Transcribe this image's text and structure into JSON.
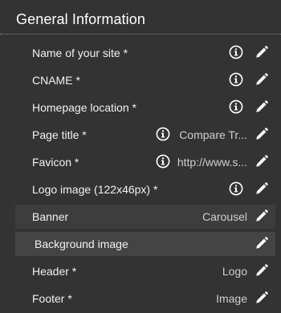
{
  "panel": {
    "title": "General Information"
  },
  "rows": [
    {
      "label": "Name of your site *",
      "value": "",
      "info": true
    },
    {
      "label": "CNAME *",
      "value": "",
      "info": true
    },
    {
      "label": "Homepage location *",
      "value": "",
      "info": true
    },
    {
      "label": "Page title *",
      "value": "Compare Tr...",
      "info": true
    },
    {
      "label": "Favicon *",
      "value": "http://www.s...",
      "info": true
    },
    {
      "label": "Logo image (122x46px) *",
      "value": "",
      "info": true
    },
    {
      "label": "Banner",
      "value": "Carousel",
      "info": false
    },
    {
      "label": "Background image",
      "value": "",
      "info": false
    },
    {
      "label": "Header *",
      "value": "Logo",
      "info": false
    },
    {
      "label": "Footer *",
      "value": "Image",
      "info": false
    }
  ],
  "icons": {
    "info": "info-circle-icon",
    "edit": "pencil-icon"
  },
  "colors": {
    "background": "#333333",
    "text": "#ffffff",
    "value_text": "#cfcfcf",
    "row_highlight": "#3d3d3d"
  }
}
